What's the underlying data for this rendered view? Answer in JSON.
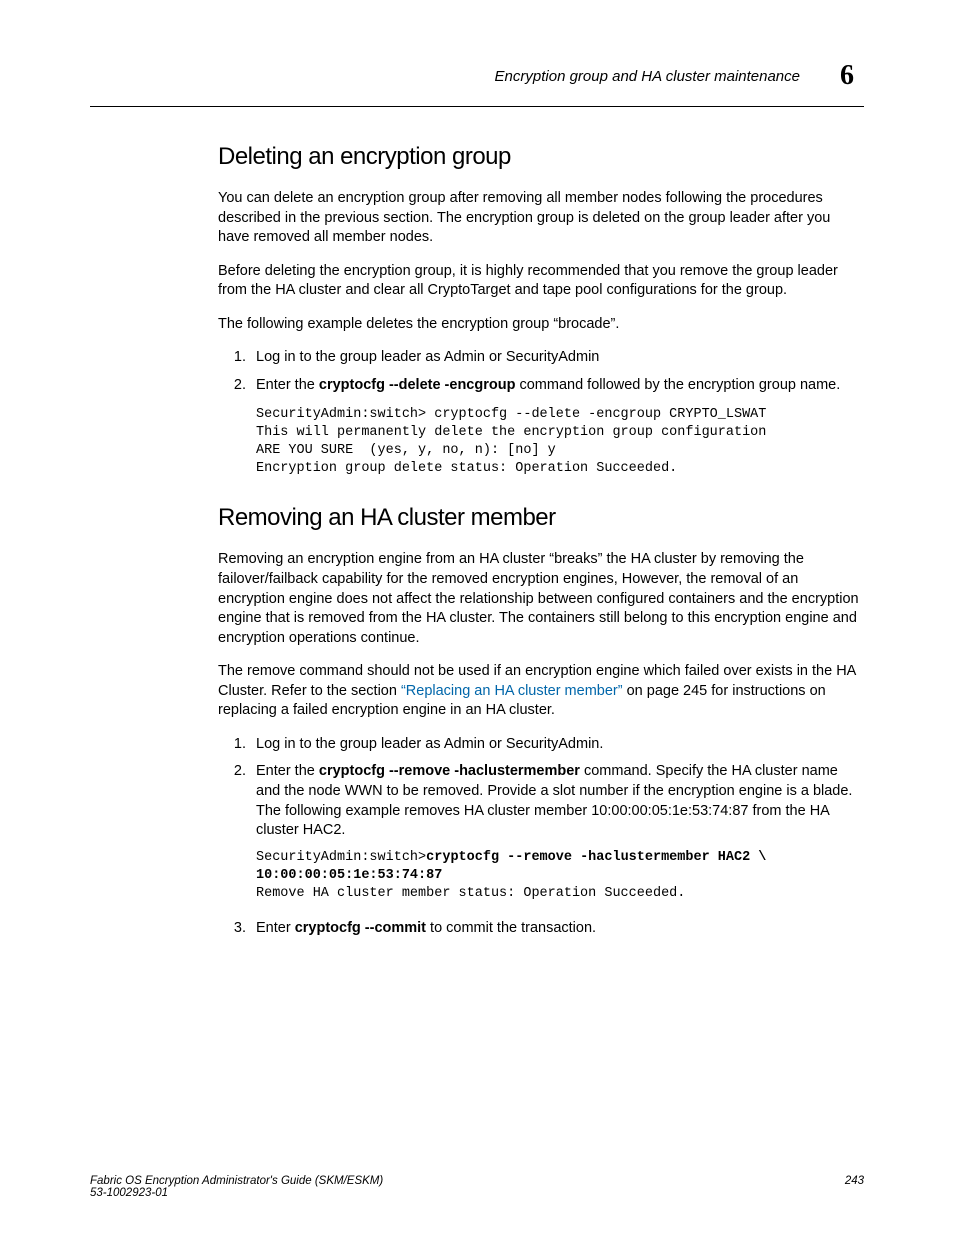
{
  "header": {
    "section_title": "Encryption group and HA cluster maintenance",
    "chapter_number": "6"
  },
  "section1": {
    "heading": "Deleting an encryption group",
    "p1": "You can delete an encryption group after removing all member nodes following the procedures described in the previous section. The encryption group is deleted on the group leader after you have removed all member nodes.",
    "p2": "Before deleting the encryption group, it is highly recommended that you remove the group leader from the HA cluster and clear all CryptoTarget and tape pool configurations for the group.",
    "p3": "The following example deletes the encryption group “brocade”.",
    "li1": "Log in to the group leader as Admin or SecurityAdmin",
    "li2_pre": "Enter the ",
    "li2_cmd": "cryptocfg  --delete  -encgroup",
    "li2_post": " command followed by the encryption group name.",
    "code": "SecurityAdmin:switch> cryptocfg --delete -encgroup CRYPTO_LSWAT\nThis will permanently delete the encryption group configuration\nARE YOU SURE  (yes, y, no, n): [no] y\nEncryption group delete status: Operation Succeeded."
  },
  "section2": {
    "heading": "Removing an HA cluster member",
    "p1": "Removing an encryption engine from an HA cluster “breaks” the HA cluster by removing the failover/failback capability for the removed encryption engines, However, the removal of an encryption engine does not affect the relationship between configured containers and the encryption engine that is removed from the HA cluster. The containers still belong to this encryption engine and encryption operations continue.",
    "p2_pre": "The remove command should not be used if an encryption engine which failed over exists in the HA Cluster. Refer to the section ",
    "p2_link": "“Replacing an HA cluster member”",
    "p2_post": " on page 245 for instructions on replacing a failed encryption engine in an HA cluster.",
    "li1": "Log in to the group leader as Admin or SecurityAdmin.",
    "li2_pre": "Enter the ",
    "li2_cmd": "cryptocfg  --remove  -haclustermember",
    "li2_post": " command. Specify the HA cluster name and the node WWN to be removed. Provide a slot number if the encryption engine is a blade. The following example removes HA cluster member 10:00:00:05:1e:53:74:87 from the HA cluster HAC2.",
    "code_prompt": "SecurityAdmin:switch>",
    "code_bold": "cryptocfg --remove -haclustermember HAC2 \\\n10:00:00:05:1e:53:74:87",
    "code_rest": "\nRemove HA cluster member status: Operation Succeeded.",
    "li3_pre": "Enter ",
    "li3_cmd": "cryptocfg  --commit",
    "li3_post": " to commit the transaction."
  },
  "footer": {
    "left_line1": "Fabric OS Encryption Administrator's Guide (SKM/ESKM)",
    "left_line2": "53-1002923-01",
    "page_number": "243"
  }
}
